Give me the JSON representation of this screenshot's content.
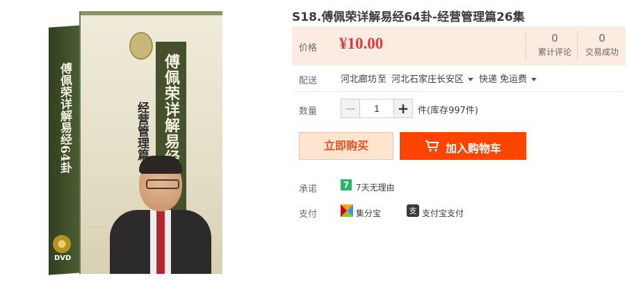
{
  "product": {
    "title": "S18.傅佩荣详解易经64卦-经营管理篇26集",
    "image_box_title": "傅佩荣详解易经64卦",
    "image_box_subtitle": "经营管理篇",
    "image_box_dvd": "DVD"
  },
  "price_panel": {
    "price_label": "价格",
    "price": "¥10.00",
    "reviews_count": "0",
    "reviews_label": "累计评论",
    "deals_count": "0",
    "deals_label": "交易成功"
  },
  "shipping": {
    "label": "配送",
    "origin": "河北廊坊",
    "to_label": "至",
    "destination": "河北石家庄长安区",
    "method": "快递 免运费"
  },
  "quantity": {
    "label": "数量",
    "minus": "−",
    "value": "1",
    "plus": "+",
    "stock": "件(库存997件)"
  },
  "actions": {
    "buy_now": "立即购买",
    "add_to_cart": "加入购物车"
  },
  "promise": {
    "label": "承诺",
    "icon_text": "7",
    "text": "7天无理由"
  },
  "payment": {
    "label": "支付",
    "methods": [
      "集分宝",
      "支付宝支付"
    ]
  },
  "colors": {
    "price_red": "#e4393c",
    "cart_orange": "#ff4400",
    "buy_now_bg": "#ffe4d0",
    "price_panel_bg": "#fcebe0"
  },
  "icons": {
    "cart": "shopping-cart-icon",
    "promise": "seven-day-return-icon",
    "jifenbao": "jifenbao-icon",
    "alipay": "alipay-icon"
  }
}
